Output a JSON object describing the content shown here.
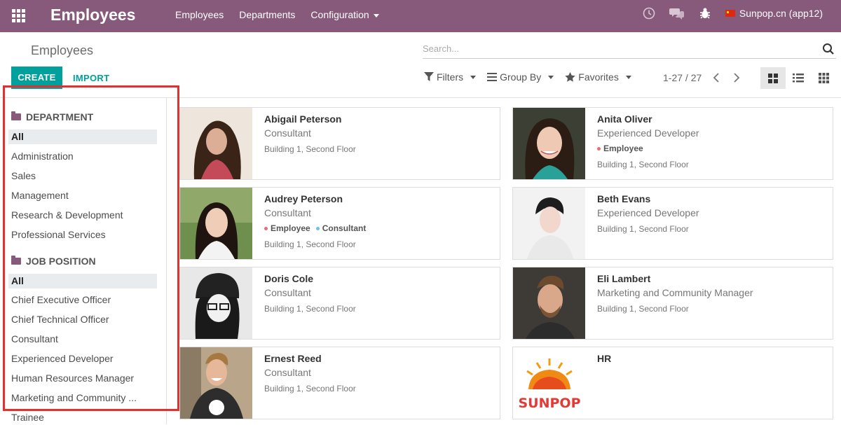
{
  "navbar": {
    "brand": "Employees",
    "menu": [
      "Employees",
      "Departments",
      "Configuration"
    ],
    "company": "Sunpop.cn (app12)"
  },
  "control": {
    "title": "Employees",
    "create": "CREATE",
    "import": "IMPORT",
    "search_placeholder": "Search...",
    "filters": "Filters",
    "group_by": "Group By",
    "favorites": "Favorites",
    "pager": "1-27 / 27"
  },
  "sidebar": {
    "department_title": "DEPARTMENT",
    "departments": [
      "All",
      "Administration",
      "Sales",
      "Management",
      "Research & Development",
      "Professional Services"
    ],
    "job_title": "JOB POSITION",
    "jobs": [
      "All",
      "Chief Executive Officer",
      "Chief Technical Officer",
      "Consultant",
      "Experienced Developer",
      "Human Resources Manager",
      "Marketing and Community ...",
      "Trainee"
    ]
  },
  "employees": [
    {
      "name": "Abigail Peterson",
      "job": "Consultant",
      "tags": [],
      "location": "Building 1, Second Floor"
    },
    {
      "name": "Anita Oliver",
      "job": "Experienced Developer",
      "tags": [
        "Employee"
      ],
      "location": "Building 1, Second Floor"
    },
    {
      "name": "Audrey Peterson",
      "job": "Consultant",
      "tags": [
        "Employee",
        "Consultant"
      ],
      "location": "Building 1, Second Floor"
    },
    {
      "name": "Beth Evans",
      "job": "Experienced Developer",
      "tags": [],
      "location": "Building 1, Second Floor"
    },
    {
      "name": "Doris Cole",
      "job": "Consultant",
      "tags": [],
      "location": "Building 1, Second Floor"
    },
    {
      "name": "Eli Lambert",
      "job": "Marketing and Community Manager",
      "tags": [],
      "location": "Building 1, Second Floor"
    },
    {
      "name": "Ernest Reed",
      "job": "Consultant",
      "tags": [],
      "location": "Building 1, Second Floor"
    },
    {
      "name": "HR",
      "logo_text": "SUNPOP"
    }
  ],
  "colors": {
    "navbar": "#875a7b",
    "primary": "#00a09d",
    "tag_employee": "#e86f6f",
    "tag_consultant": "#6ec1e4",
    "highlight": "#e03131"
  }
}
